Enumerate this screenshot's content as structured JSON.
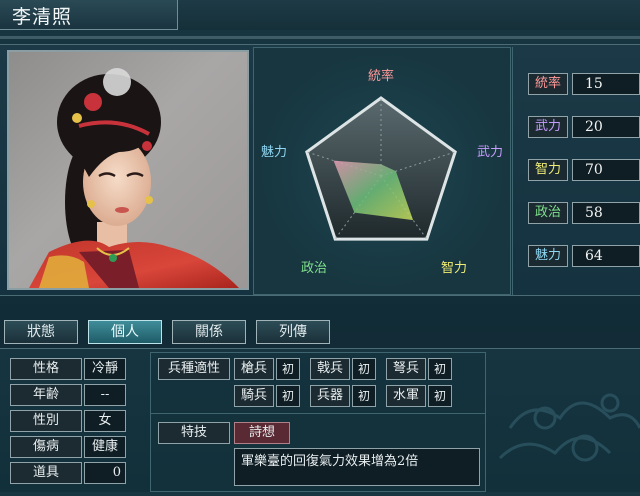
{
  "officer": {
    "name": "李清照"
  },
  "radar": {
    "labels": {
      "lead": "統率",
      "war": "武力",
      "int": "智力",
      "pol": "政治",
      "chr": "魅力"
    },
    "colors": {
      "lead": "#ff9a9a",
      "war": "#c79cff",
      "int": "#f0ec76",
      "pol": "#7fe08c",
      "chr": "#8fd6f2"
    },
    "max": 100
  },
  "stats": [
    {
      "key": "lead",
      "label": "統率",
      "value": 15,
      "color": "#ff9a9a"
    },
    {
      "key": "war",
      "label": "武力",
      "value": 20,
      "color": "#c79cff"
    },
    {
      "key": "int",
      "label": "智力",
      "value": 70,
      "color": "#f0ec76"
    },
    {
      "key": "pol",
      "label": "政治",
      "value": 58,
      "color": "#7fe08c"
    },
    {
      "key": "chr",
      "label": "魅力",
      "value": 64,
      "color": "#8fd6f2"
    }
  ],
  "tabs": [
    {
      "label": "狀態"
    },
    {
      "label": "個人"
    },
    {
      "label": "關係"
    },
    {
      "label": "列傳"
    }
  ],
  "active_tab": "個人",
  "personal": [
    {
      "label": "性格",
      "value": "冷靜"
    },
    {
      "label": "年齢",
      "value": "--"
    },
    {
      "label": "性別",
      "value": "女"
    },
    {
      "label": "傷病",
      "value": "健康"
    },
    {
      "label": "道具",
      "value": "0"
    }
  ],
  "aptitude": {
    "title": "兵種適性",
    "items": [
      {
        "label": "槍兵",
        "value": "初"
      },
      {
        "label": "戟兵",
        "value": "初"
      },
      {
        "label": "弩兵",
        "value": "初"
      },
      {
        "label": "騎兵",
        "value": "初"
      },
      {
        "label": "兵器",
        "value": "初"
      },
      {
        "label": "水軍",
        "value": "初"
      }
    ]
  },
  "skill": {
    "title": "特技",
    "name": "詩想",
    "description": "軍樂臺的回復氣力效果增為2倍"
  }
}
